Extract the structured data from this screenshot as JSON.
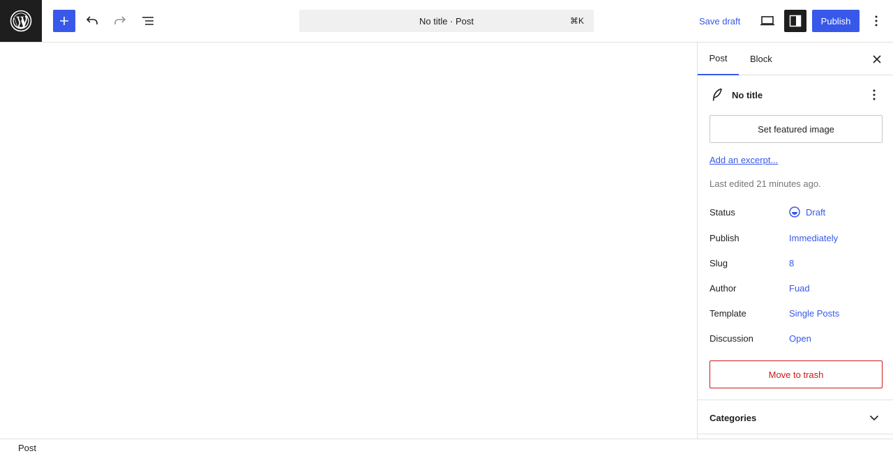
{
  "colors": {
    "accent": "#3858e9",
    "dark": "#1e1e1e",
    "muted": "#757575",
    "danger": "#cc1818",
    "border": "#e0e0e0"
  },
  "header": {
    "logo_icon": "wordpress-logo-icon",
    "add_icon": "plus-icon",
    "undo_icon": "undo-icon",
    "redo_icon": "redo-icon",
    "list_view_icon": "list-view-icon",
    "command_title": "No title · Post",
    "command_shortcut": "⌘K",
    "save_draft_label": "Save draft",
    "preview_icon": "desktop-preview-icon",
    "settings_icon": "sidebar-toggle-icon",
    "publish_label": "Publish",
    "options_icon": "more-vertical-icon"
  },
  "sidebar": {
    "tabs": [
      {
        "label": "Post",
        "active": true
      },
      {
        "label": "Block",
        "active": false
      }
    ],
    "close_icon": "close-icon",
    "post_card": {
      "icon": "feather-icon",
      "title": "No title",
      "menu_icon": "more-vertical-icon"
    },
    "featured_image_label": "Set featured image",
    "excerpt_link": "Add an excerpt...",
    "last_edited": "Last edited 21 minutes ago.",
    "rows": [
      {
        "label": "Status",
        "value": "Draft"
      },
      {
        "label": "Publish",
        "value": "Immediately"
      },
      {
        "label": "Slug",
        "value": "8"
      },
      {
        "label": "Author",
        "value": "Fuad"
      },
      {
        "label": "Template",
        "value": "Single Posts"
      },
      {
        "label": "Discussion",
        "value": "Open"
      }
    ],
    "trash_label": "Move to trash",
    "categories": {
      "label": "Categories",
      "chevron_icon": "chevron-down-icon"
    }
  },
  "footer": {
    "breadcrumb": "Post"
  }
}
